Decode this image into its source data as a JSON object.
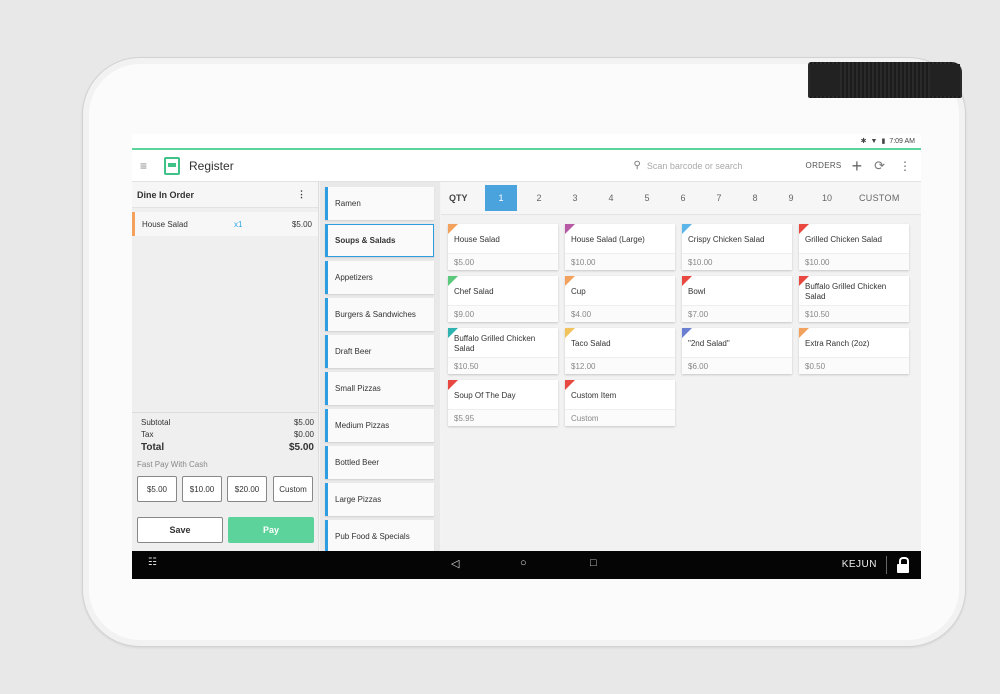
{
  "status": {
    "time": "7:09 AM"
  },
  "appbar": {
    "title": "Register",
    "search_placeholder": "Scan barcode or search",
    "orders_label": "ORDERS",
    "plus": "+",
    "refresh": "⟳",
    "more": "⋮",
    "menu": "≡"
  },
  "order": {
    "title": "Dine In Order",
    "more": "⋮",
    "lines": [
      {
        "name": "House Salad",
        "qty": "x1",
        "price": "$5.00"
      }
    ],
    "subtotal_label": "Subtotal",
    "subtotal": "$5.00",
    "tax_label": "Tax",
    "tax": "$0.00",
    "total_label": "Total",
    "total": "$5.00",
    "fastpay_label": "Fast Pay With Cash",
    "cash": [
      "$5.00",
      "$10.00",
      "$20.00",
      "Custom"
    ],
    "save": "Save",
    "pay": "Pay"
  },
  "categories": [
    "Ramen",
    "Soups & Salads",
    "Appetizers",
    "Burgers & Sandwiches",
    "Draft Beer",
    "Small Pizzas",
    "Medium Pizzas",
    "Bottled Beer",
    "Large Pizzas",
    "Pub Food & Specials"
  ],
  "active_category": "Soups & Salads",
  "qty": {
    "label": "QTY",
    "numbers": [
      "1",
      "2",
      "3",
      "4",
      "5",
      "6",
      "7",
      "8",
      "9",
      "10"
    ],
    "selected": "1",
    "custom": "CUSTOM"
  },
  "items": [
    {
      "name": "House Salad",
      "price": "$5.00",
      "color": "#f2a25c"
    },
    {
      "name": "House Salad (Large)",
      "price": "$10.00",
      "color": "#b65aa6"
    },
    {
      "name": "Crispy Chicken Salad",
      "price": "$10.00",
      "color": "#5ab6e8"
    },
    {
      "name": "Grilled Chicken Salad",
      "price": "$10.00",
      "color": "#e8483f"
    },
    {
      "name": "Chef Salad",
      "price": "$9.00",
      "color": "#5bc87c"
    },
    {
      "name": "Cup",
      "price": "$4.00",
      "color": "#f2a25c"
    },
    {
      "name": "Bowl",
      "price": "$7.00",
      "color": "#e8483f"
    },
    {
      "name": "Buffalo Grilled Chicken Salad",
      "price": "$10.50",
      "color": "#e8483f"
    },
    {
      "name": "Buffalo Grilled Chicken Salad",
      "price": "$10.50",
      "color": "#2fb3b0"
    },
    {
      "name": "Taco Salad",
      "price": "$12.00",
      "color": "#f2c25c"
    },
    {
      "name": "\"2nd Salad\"",
      "price": "$6.00",
      "color": "#6a7fd1"
    },
    {
      "name": "Extra Ranch (2oz)",
      "price": "$0.50",
      "color": "#f2a25c"
    },
    {
      "name": "Soup Of The Day",
      "price": "$5.95",
      "color": "#e8483f"
    },
    {
      "name": "Custom Item",
      "price": "Custom",
      "color": "#e8483f"
    }
  ],
  "navbar": {
    "user": "KEJUN",
    "back": "◁",
    "home": "○",
    "recents": "□",
    "menu": "☷"
  }
}
